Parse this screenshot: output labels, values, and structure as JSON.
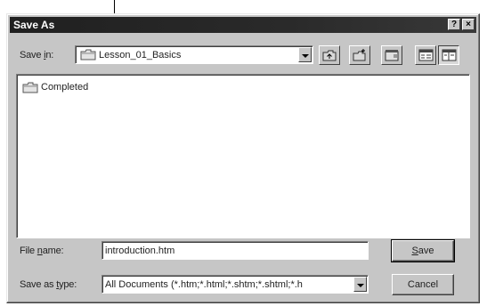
{
  "window": {
    "title": "Save As"
  },
  "titlebar_buttons": {
    "help": "?",
    "close": "×"
  },
  "save_in": {
    "label_prefix": "Save ",
    "label_accel": "i",
    "label_suffix": "n:",
    "value": "Lesson_01_Basics"
  },
  "toolbar": {
    "icons": [
      "up-one-level-icon",
      "create-new-folder-icon",
      "desktop-icon",
      "list-view-icon",
      "details-view-icon"
    ]
  },
  "files": [
    {
      "name": "Completed",
      "icon": "folder-icon"
    }
  ],
  "file_name": {
    "label_prefix": "File ",
    "label_accel": "n",
    "label_suffix": "ame:",
    "value": "introduction.htm"
  },
  "save_as_type": {
    "label_prefix": "Save as ",
    "label_accel": "t",
    "label_suffix": "ype:",
    "value": "All Documents (*.htm;*.html;*.shtm;*.shtml;*.h"
  },
  "buttons": {
    "save_accel": "S",
    "save_rest": "ave",
    "cancel": "Cancel"
  }
}
